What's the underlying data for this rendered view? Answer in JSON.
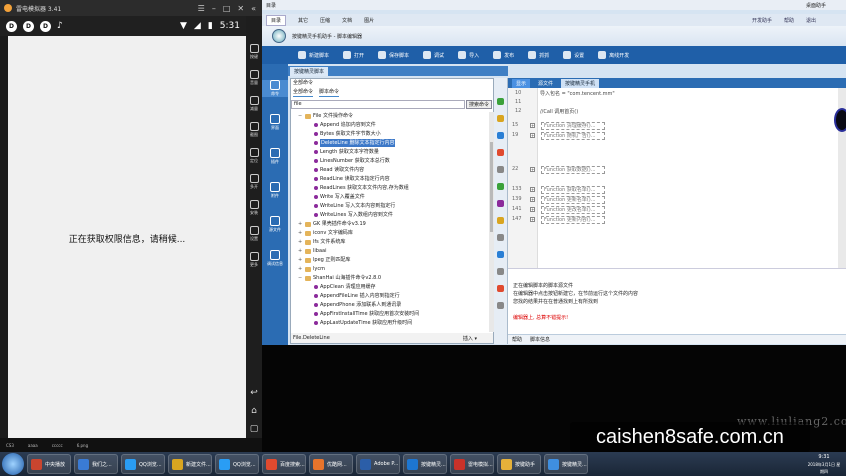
{
  "emulator": {
    "title": "雷电模拟器 3.41",
    "time": "5:31",
    "loading_message": "正在获取权限信息，请稍候...",
    "side_buttons": [
      "按键",
      "音量",
      "减量",
      "截图",
      "定位",
      "多开",
      "安装",
      "设置",
      "更多"
    ],
    "desktop_labels": [
      "CS3",
      "aaaa",
      "ccccc",
      "6.png"
    ]
  },
  "ide": {
    "menubar_title": "目录",
    "menubar_right": "桌面助手",
    "tabs": [
      "目录",
      "其它",
      "压缩",
      "文档",
      "图片"
    ],
    "tabs_right": [
      "开发助手",
      "帮助",
      "退出"
    ],
    "banner_title": "按键精灵手机助手 - 脚本编辑器",
    "toolbar": [
      "新建脚本",
      "打开",
      "保存脚本",
      "调试",
      "导入",
      "发布",
      "抓抓",
      "设置",
      "离线开发"
    ],
    "leftnav": [
      "命令",
      "界面",
      "插件",
      "附件",
      "源文件",
      "调试信息"
    ],
    "panel_tab": "按键精灵脚本",
    "cmd_head": "全部命令",
    "cmd_subtabs": [
      "全部命令",
      "脚本命令"
    ],
    "search_value": "file",
    "search_button": "搜索命令",
    "tree": [
      {
        "level": 1,
        "kind": "folder",
        "toggle": "−",
        "text": "File 文件操作命令"
      },
      {
        "level": 2,
        "kind": "leaf",
        "text": "Append 追加内容到文件"
      },
      {
        "level": 2,
        "kind": "leaf",
        "text": "Bytes 获取文件字节数大小"
      },
      {
        "level": 2,
        "kind": "leaf",
        "text": "DeleteLine 删除文本指定行内容",
        "selected": true
      },
      {
        "level": 2,
        "kind": "leaf",
        "text": "Length 获取文本字符数量"
      },
      {
        "level": 2,
        "kind": "leaf",
        "text": "LinesNumber 获取文本总行数"
      },
      {
        "level": 2,
        "kind": "leaf",
        "text": "Read 读取文件内容"
      },
      {
        "level": 2,
        "kind": "leaf",
        "text": "ReadLine 读取文本指定行内容"
      },
      {
        "level": 2,
        "kind": "leaf",
        "text": "ReadLines 获取文本文件内容,存为数组"
      },
      {
        "level": 2,
        "kind": "leaf",
        "text": "Write 写入覆盖文件"
      },
      {
        "level": 2,
        "kind": "leaf",
        "text": "WriteLine 写入文本内容到指定行"
      },
      {
        "level": 2,
        "kind": "leaf",
        "text": "WriteLines 写入数组内容到文件"
      },
      {
        "level": 1,
        "kind": "folder",
        "toggle": "+",
        "text": "GK 果壳插件命令v3.19"
      },
      {
        "level": 1,
        "kind": "folder",
        "toggle": "+",
        "text": "iconv 文字编码库"
      },
      {
        "level": 1,
        "kind": "folder",
        "toggle": "+",
        "text": "lfs 文件系统库"
      },
      {
        "level": 1,
        "kind": "folder",
        "toggle": "+",
        "text": "libaai"
      },
      {
        "level": 1,
        "kind": "folder",
        "toggle": "+",
        "text": "lpeg 正则匹配库"
      },
      {
        "level": 1,
        "kind": "folder",
        "toggle": "+",
        "text": "lycm"
      },
      {
        "level": 1,
        "kind": "folder",
        "toggle": "−",
        "text": "ShanHai 山海插件命令v2.8.0"
      },
      {
        "level": 2,
        "kind": "leaf",
        "text": "AppClean 清理应用缓存"
      },
      {
        "level": 2,
        "kind": "leaf",
        "text": "AppendFileLine 插入内容到指定行"
      },
      {
        "level": 2,
        "kind": "leaf",
        "text": "AppendPhone 添加联系人到通讯录"
      },
      {
        "level": 2,
        "kind": "leaf",
        "text": "AppFirstInstallTime 获取应用首次安装时间"
      },
      {
        "level": 2,
        "kind": "leaf",
        "text": "AppLastUpdateTime 获取应用升级时间"
      }
    ],
    "cmd_status": "File.DeleteLine",
    "cmd_status_right": "插入 ▾",
    "editor_tabs": [
      "显示",
      "源文件"
    ],
    "editor_file": "按键精灵手机",
    "code_lines": [
      {
        "n": "10",
        "t": "导入包名 = \"com.tencent.mm\""
      },
      {
        "n": "11",
        "t": ""
      },
      {
        "n": "12",
        "t": "//Call 调用首页()"
      }
    ],
    "fn_boxes": [
      {
        "n": "15",
        "t": "Function 清理缓存()..."
      },
      {
        "n": "19",
        "t": "Function 随机广告()..."
      },
      {
        "n": "22",
        "t": "Function 获取数据()..."
      },
      {
        "n": "133",
        "t": "Function 获取名单()..."
      },
      {
        "n": "139",
        "t": "Function 更新名单()..."
      },
      {
        "n": "141",
        "t": "Function 更改名单()..."
      },
      {
        "n": "147",
        "t": "Function 更新内容()..."
      }
    ],
    "output_lines": [
      "正在编辑脚本的脚本源文件",
      "在编辑器中点击按钮新建它，在节前运行这个文件的内容",
      "您找的结果并在在普通找到上有所找到",
      "",
      "编辑器上, 总算不错提示!"
    ],
    "output_tabs": [
      "帮助",
      "脚本信息"
    ],
    "clock_time": "9:31",
    "clock_date": "2018年3月1日 星期四"
  },
  "watermark": {
    "small": "www.liuliang2.com",
    "big": "caishen8safe.com.cn"
  },
  "taskbar": [
    {
      "label": "中央播放",
      "color": "#c9452f"
    },
    {
      "label": "我们之...",
      "color": "#3a7bd5"
    },
    {
      "label": "QQ浏览...",
      "color": "#2a9df4"
    },
    {
      "label": "新建文件...",
      "color": "#d9a520"
    },
    {
      "label": "QQ浏览...",
      "color": "#2a9df4"
    },
    {
      "label": "百度搜索...",
      "color": "#e04a2f"
    },
    {
      "label": "优酷网...",
      "color": "#e8742b"
    },
    {
      "label": "Adobe P...",
      "color": "#2b5ea8"
    },
    {
      "label": "按键精灵...",
      "color": "#1d76d1"
    },
    {
      "label": "雷电模拟...",
      "color": "#c8322a"
    },
    {
      "label": "按键助手",
      "color": "#e5b13a"
    },
    {
      "label": "按键精灵...",
      "color": "#3f8fe0"
    }
  ],
  "colors": {
    "ide_toolbar": "#1f5fa8",
    "leftnav": "#2b6cb3",
    "selection": "#3c78c8",
    "error_text": "#dd0000"
  }
}
